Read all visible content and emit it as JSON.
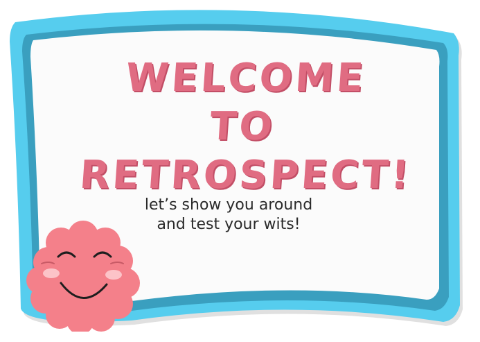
{
  "welcome": {
    "title_line1": "WELCOME TO",
    "title_line2": "RETROSPECT!",
    "subtitle_line1": "let’s show you around",
    "subtitle_line2": "and test your wits!"
  },
  "icons": {
    "mascot": "smiling-pink-blob-icon"
  },
  "colors": {
    "frame_outer": "#56cdee",
    "frame_dark": "#3a9fbf",
    "panel": "#fbfbfb",
    "title": "#e06c82",
    "mascot_body": "#f4808a",
    "mascot_cheek": "#fcc3c8"
  }
}
